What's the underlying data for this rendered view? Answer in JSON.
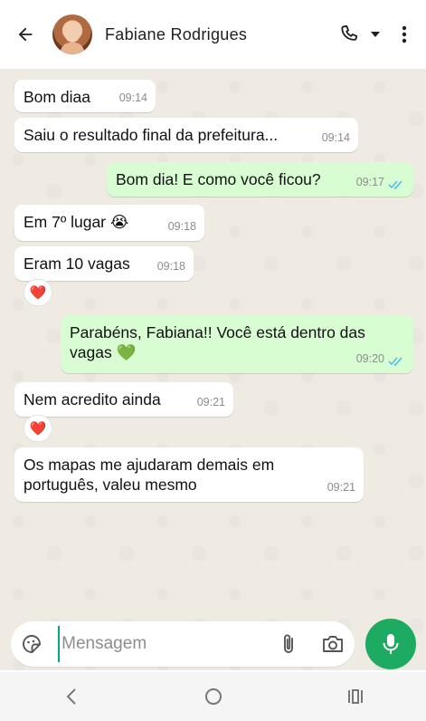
{
  "header": {
    "contact_name": "Fabiane Rodrigues"
  },
  "messages": [
    {
      "direction": "in",
      "text": "Bom diaa",
      "time": "09:14"
    },
    {
      "direction": "in",
      "text": "Saiu o resultado final da prefeitura...",
      "time": "09:14"
    },
    {
      "direction": "out",
      "text": "Bom dia! E como você ficou?",
      "time": "09:17",
      "status": "read"
    },
    {
      "direction": "in",
      "text": "Em 7º lugar 😭",
      "time": "09:18"
    },
    {
      "direction": "in",
      "text": "Eram 10 vagas",
      "time": "09:18",
      "reaction": "❤️"
    },
    {
      "direction": "out",
      "text": "Parabéns, Fabiana!! Você está dentro das vagas 💚",
      "time": "09:20",
      "status": "read"
    },
    {
      "direction": "in",
      "text": "Nem acredito ainda",
      "time": "09:21",
      "reaction": "❤️"
    },
    {
      "direction": "in",
      "text": "Os mapas me ajudaram demais em português, valeu mesmo",
      "time": "09:21"
    }
  ],
  "composer": {
    "placeholder": "Mensagem"
  },
  "icons": {
    "back": "arrow-left-icon",
    "call": "phone-icon",
    "call_menu": "caret-down-icon",
    "more": "kebab-menu-icon",
    "sticker": "sticker-icon",
    "attach": "paperclip-icon",
    "camera": "camera-icon",
    "mic": "microphone-icon"
  },
  "colors": {
    "outgoing_bubble": "#d9fdd3",
    "incoming_bubble": "#ffffff",
    "accent": "#1daa61",
    "read_ticks": "#53bdeb",
    "chat_background": "#efeae2"
  }
}
